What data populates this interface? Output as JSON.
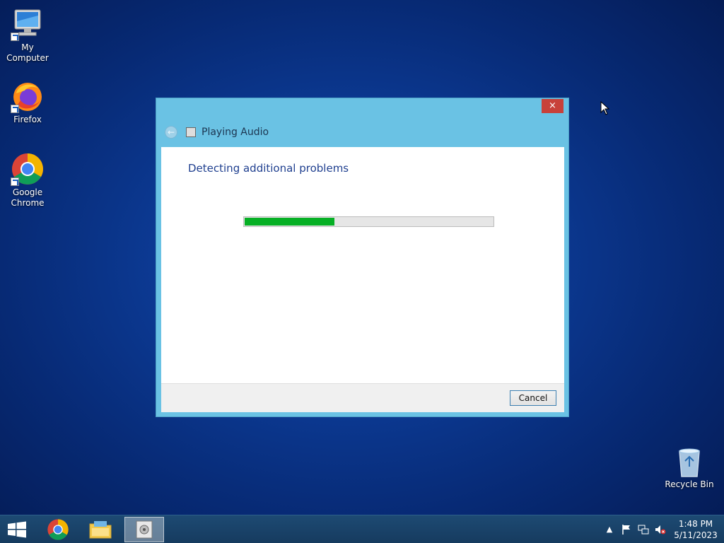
{
  "desktop": {
    "icons": [
      {
        "label": "My Computer"
      },
      {
        "label": "Firefox"
      },
      {
        "label": "Google Chrome"
      },
      {
        "label": "Recycle Bin"
      }
    ]
  },
  "dialog": {
    "close_label": "×",
    "title": "Playing Audio",
    "heading": "Detecting additional problems",
    "progress_fraction": 0.36,
    "cancel_label": "Cancel"
  },
  "taskbar": {
    "items": [
      "start-icon",
      "chrome-icon",
      "file-explorer-icon",
      "troubleshooter-icon"
    ],
    "tray": [
      "show-hidden-icons",
      "action-center-flag-icon",
      "network-icon",
      "speaker-muted-icon"
    ],
    "time": "1:48 PM",
    "date": "5/11/2023"
  },
  "colors": {
    "dialog_frame": "#6ac2e4",
    "progress_fill": "#06b025",
    "close_button": "#c8413a"
  }
}
